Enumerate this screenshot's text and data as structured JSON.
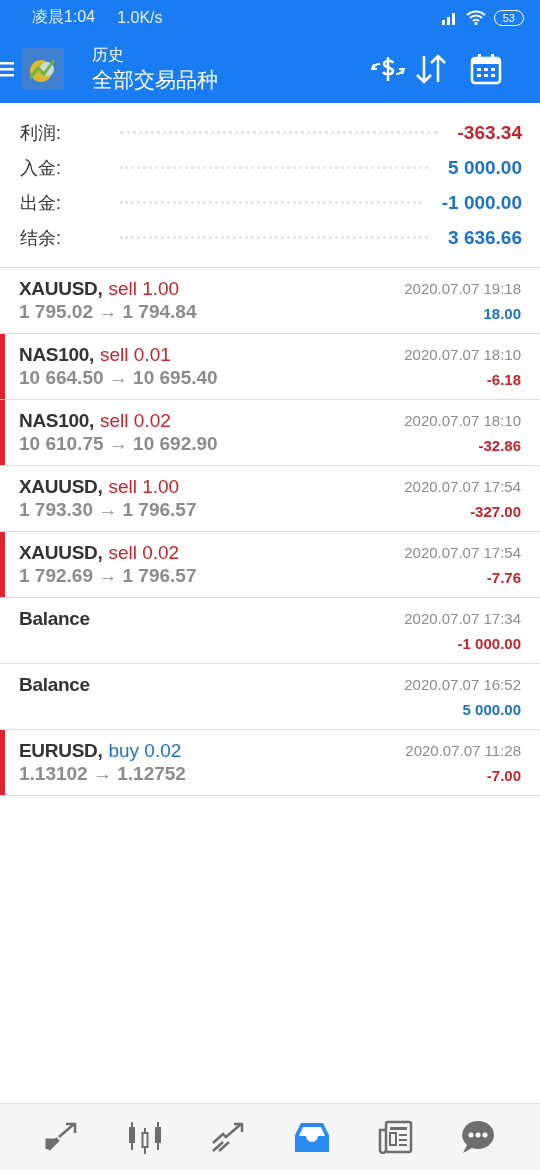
{
  "status_bar": {
    "time": "凌晨1:04",
    "speed": "1.0K/s",
    "battery": "53"
  },
  "header": {
    "title": "历史",
    "subtitle": "全部交易品种"
  },
  "summary": [
    {
      "label": "利润:",
      "value": "-363.34",
      "loss": true
    },
    {
      "label": "入金:",
      "value": "5 000.00",
      "loss": false
    },
    {
      "label": "出金:",
      "value": "-1 000.00",
      "loss": false
    },
    {
      "label": "结余:",
      "value": "3 636.66",
      "loss": false
    }
  ],
  "deals": [
    {
      "kind": "trade",
      "symbol": "XAUUSD,",
      "buy": false,
      "volume": "sell 1.00",
      "prices": "1 795.02 → 1 794.84",
      "time": "2020.07.07 19:18",
      "profit": "18.00",
      "gain": true,
      "marked": false
    },
    {
      "kind": "trade",
      "symbol": "NAS100,",
      "buy": false,
      "volume": "sell 0.01",
      "prices": "10 664.50 → 10 695.40",
      "time": "2020.07.07 18:10",
      "profit": "-6.18",
      "gain": false,
      "marked": true
    },
    {
      "kind": "trade",
      "symbol": "NAS100,",
      "buy": false,
      "volume": "sell 0.02",
      "prices": "10 610.75 → 10 692.90",
      "time": "2020.07.07 18:10",
      "profit": "-32.86",
      "gain": false,
      "marked": true
    },
    {
      "kind": "trade",
      "symbol": "XAUUSD,",
      "buy": false,
      "volume": "sell 1.00",
      "prices": "1 793.30 → 1 796.57",
      "time": "2020.07.07 17:54",
      "profit": "-327.00",
      "gain": false,
      "marked": false
    },
    {
      "kind": "trade",
      "symbol": "XAUUSD,",
      "buy": false,
      "volume": "sell 0.02",
      "prices": "1 792.69 → 1 796.57",
      "time": "2020.07.07 17:54",
      "profit": "-7.76",
      "gain": false,
      "marked": true
    },
    {
      "kind": "balance",
      "symbol": "Balance",
      "time": "2020.07.07 17:34",
      "profit": "-1 000.00",
      "gain": false,
      "marked": false
    },
    {
      "kind": "balance",
      "symbol": "Balance",
      "time": "2020.07.07 16:52",
      "profit": "5 000.00",
      "gain": true,
      "marked": false
    },
    {
      "kind": "trade",
      "symbol": "EURUSD,",
      "buy": true,
      "volume": "buy 0.02",
      "prices": "1.13102 → 1.12752",
      "time": "2020.07.07 11:28",
      "profit": "-7.00",
      "gain": false,
      "marked": true
    }
  ],
  "nav": [
    {
      "kind": "trade",
      "selected": false
    },
    {
      "kind": "quotes",
      "selected": false
    },
    {
      "kind": "chart",
      "selected": false
    },
    {
      "kind": "history",
      "selected": true
    },
    {
      "kind": "news",
      "selected": false
    },
    {
      "kind": "chat",
      "selected": false
    }
  ]
}
